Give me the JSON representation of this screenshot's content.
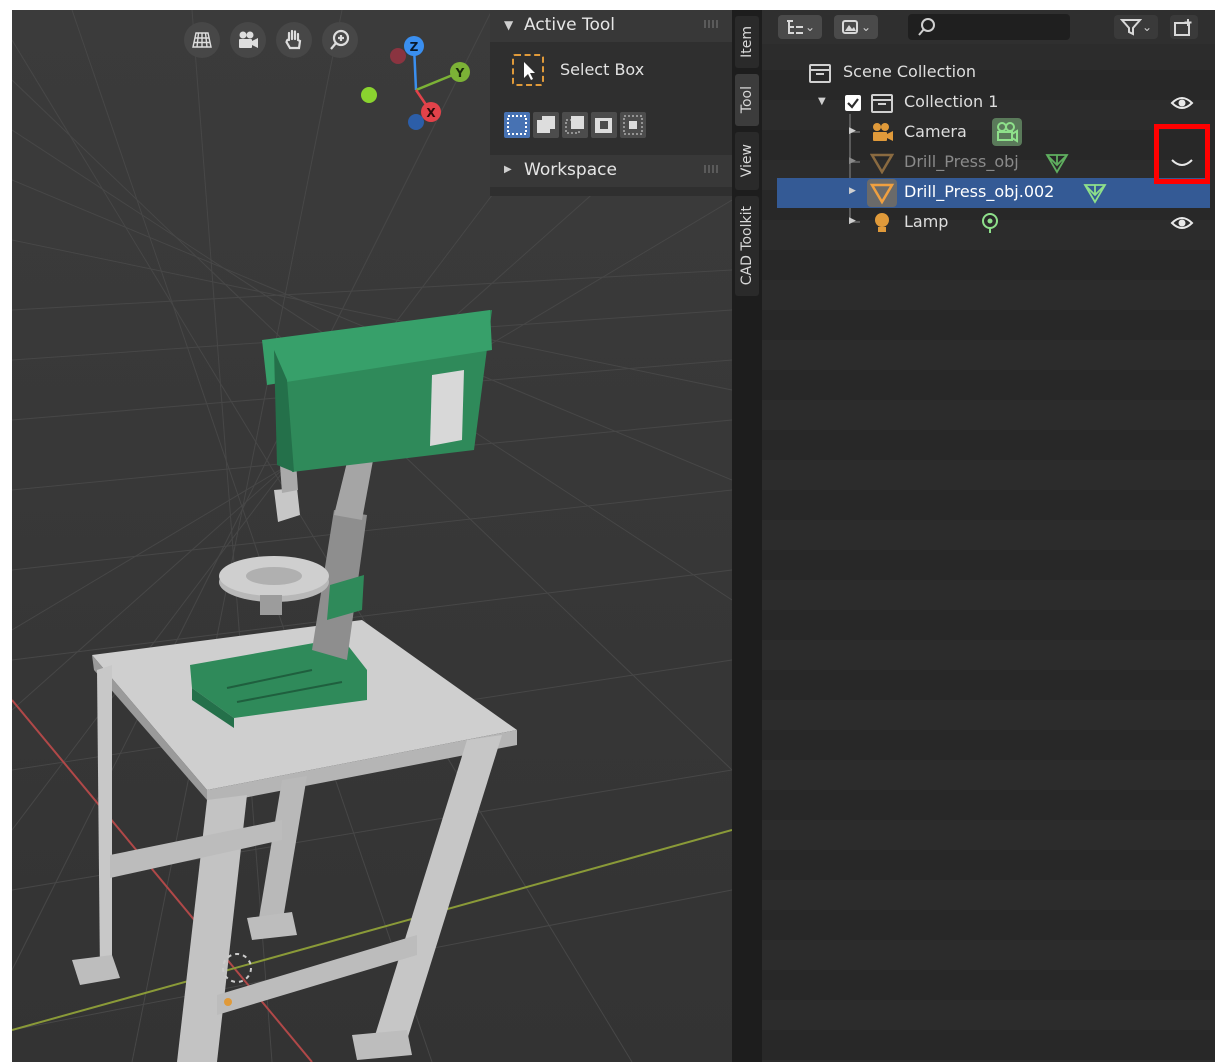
{
  "viewport": {
    "nav_icons": [
      "grid-icon",
      "camera-icon",
      "hand-pan-icon",
      "zoom-icon"
    ],
    "gizmo": {
      "x": "X",
      "y": "Y",
      "z": "Z"
    }
  },
  "npanel": {
    "active_tool_header": "Active Tool",
    "active_tool_label": "Select Box",
    "workspace_header": "Workspace"
  },
  "tabs": [
    "Item",
    "Tool",
    "View",
    "CAD Toolkit"
  ],
  "outliner": {
    "scene_collection": "Scene Collection",
    "collection": "Collection 1",
    "objects": [
      {
        "name": "Camera",
        "icon": "camera-icon",
        "color": "#e09a3a"
      },
      {
        "name": "Drill_Press_obj",
        "icon": "mesh-icon",
        "color": "#e09a3a",
        "hidden": true
      },
      {
        "name": "Drill_Press_obj.002",
        "icon": "mesh-icon",
        "color": "#e09a3a",
        "selected": true
      },
      {
        "name": "Lamp",
        "icon": "lamp-icon",
        "color": "#e09a3a"
      }
    ]
  },
  "colors": {
    "accent": "#4772b3",
    "selection_row": "#345a95",
    "highlight": "#ff0000",
    "object_green": "#2f8a5a",
    "data_green": "#6ecf7a"
  }
}
